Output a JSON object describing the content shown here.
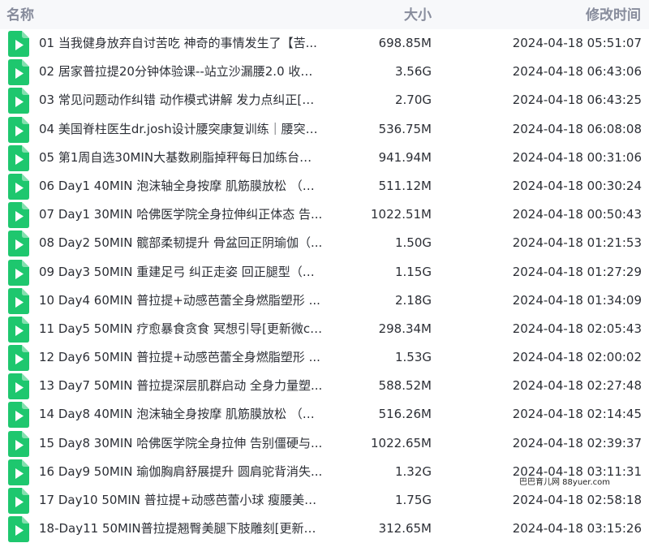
{
  "columns": {
    "name": "名称",
    "size": "大小",
    "modified": "修改时间"
  },
  "file_icon": "video-file-icon",
  "colors": {
    "icon_green": "#1ec76e",
    "header_bg": "#f7f8fa",
    "header_text": "#878c9c",
    "row_text": "#2c2f36"
  },
  "files": [
    {
      "name": "01 当我健身放弃自讨苦吃 神奇的事情发生了【苦...",
      "size": "698.85M",
      "time": "2024-04-18 05:51:07"
    },
    {
      "name": "02 居家普拉提20分钟体验课--站立沙漏腰2.0 收出...",
      "size": "3.56G",
      "time": "2024-04-18 06:43:06"
    },
    {
      "name": "03 常见问题动作纠错 动作模式讲解 发力点纠正[更...",
      "size": "2.70G",
      "time": "2024-04-18 06:43:25"
    },
    {
      "name": "04 美国脊柱医生dr.josh设计腰突康复训练｜腰突人...",
      "size": "536.75M",
      "time": "2024-04-18 06:08:08"
    },
    {
      "name": "05 第1周自选30MIN大基数刷脂掉秤每日加练台阶...",
      "size": "941.94M",
      "time": "2024-04-18 00:31:06"
    },
    {
      "name": "06 Day1 40MIN 泡沫轴全身按摩 肌筋膜放松 （生...",
      "size": "511.12M",
      "time": "2024-04-18 00:30:24"
    },
    {
      "name": "07 Day1 30MIN 哈佛医学院全身拉伸纠正体态 告...",
      "size": "1022.51M",
      "time": "2024-04-18 00:50:43"
    },
    {
      "name": "08 Day2 50MIN 髋部柔韧提升 骨盆回正阴瑜伽（...",
      "size": "1.50G",
      "time": "2024-04-18 01:21:53"
    },
    {
      "name": "09 Day3 50MIN 重建足弓 纠正走姿 回正腿型（生...",
      "size": "1.15G",
      "time": "2024-04-18 01:27:29"
    },
    {
      "name": "10 Day4 60MIN 普拉提+动感芭蕾全身燃脂塑形 ...",
      "size": "2.18G",
      "time": "2024-04-18 01:34:09"
    },
    {
      "name": "11 Day5 50MIN 疗愈暴食贪食 冥想引导[更新微co...",
      "size": "298.34M",
      "time": "2024-04-18 02:05:43"
    },
    {
      "name": "12 Day6 50MIN 普拉提+动感芭蕾全身燃脂塑形 ...",
      "size": "1.53G",
      "time": "2024-04-18 02:00:02"
    },
    {
      "name": "13 Day7 50MIN 普拉提深层肌群启动 全身力量塑...",
      "size": "588.52M",
      "time": "2024-04-18 02:27:48"
    },
    {
      "name": "14 Day8 40MIN 泡沫轴全身按摩 肌筋膜放松 （复...",
      "size": "516.26M",
      "time": "2024-04-18 02:14:45"
    },
    {
      "name": "15 Day8 30MIN 哈佛医学院全身拉伸 告别僵硬与...",
      "size": "1022.65M",
      "time": "2024-04-18 02:39:37"
    },
    {
      "name": "16 Day9 50MIN 瑜伽胸肩舒展提升 圆肩驼背消失...",
      "size": "1.32G",
      "time": "2024-04-18 03:11:31"
    },
    {
      "name": "17 Day10 50MIN 普拉提+动感芭蕾小球 瘦腰美背...",
      "size": "1.75G",
      "time": "2024-04-18 02:58:18"
    },
    {
      "name": "18-Day11 50MIN普拉提翘臀美腿下肢雕刻[更新微...",
      "size": "312.65M",
      "time": "2024-04-18 03:15:26"
    }
  ],
  "watermark": "巴巴育儿网 88yuer.com"
}
